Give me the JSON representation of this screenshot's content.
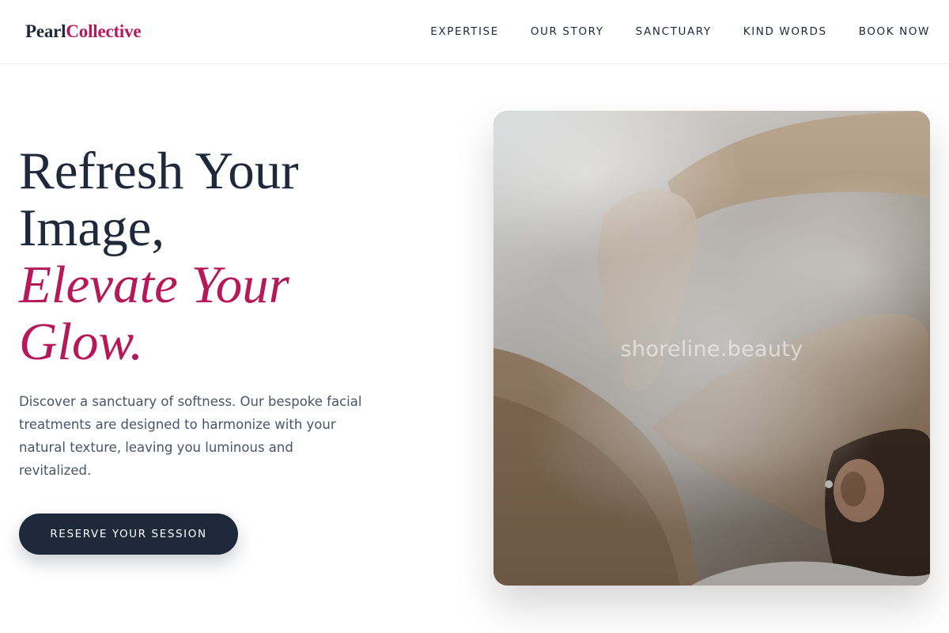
{
  "header": {
    "logo_part1": "Pearl",
    "logo_part2": "Collective",
    "nav": [
      "EXPERTISE",
      "OUR STORY",
      "SANCTUARY",
      "KIND WORDS",
      "BOOK NOW"
    ]
  },
  "hero": {
    "title_line1": "Refresh Your",
    "title_line2": "Image,",
    "title_accent_line1": "Elevate Your",
    "title_accent_line2": "Glow.",
    "description": "Discover a sanctuary of softness. Our bespoke facial treatments are designed to harmonize with your natural texture, leaving you luminous and revitalized.",
    "cta_label": "RESERVE YOUR SESSION",
    "image_watermark": "shoreline.beauty"
  },
  "colors": {
    "navy": "#1e293b",
    "accent": "#b5195a",
    "body_text": "#475569"
  },
  "icons": {
    "hero_image": "spa-facial-steam-photo"
  }
}
